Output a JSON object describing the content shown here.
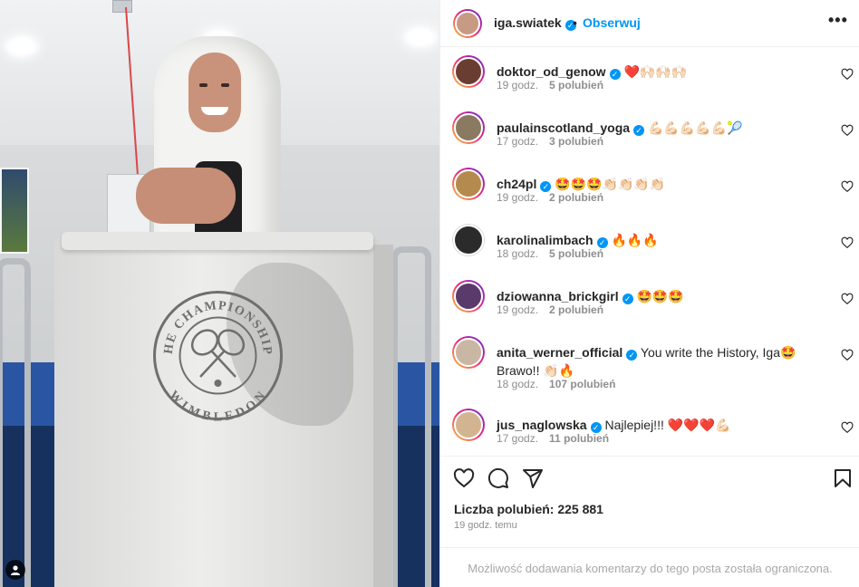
{
  "post": {
    "author": "iga.swiatek",
    "verified": true,
    "separator": "•",
    "follow_label": "Obserwuj",
    "more_icon": "more-horizontal-icon",
    "photo_logo_top": "THE CHAMPIONSHIPS",
    "photo_logo_bottom": "WIMBLEDON",
    "likes_label": "Liczba polubień: 225 881",
    "time_label": "19 godz. temu",
    "comments_restricted": "Możliwość dodawania komentarzy do tego posta została ograniczona."
  },
  "comments": [
    {
      "user": "doktor_od_genow",
      "text": "❤️🙌🏻🙌🏻🙌🏻",
      "time": "19 godz.",
      "likes": "5 polubień",
      "avatar_color": "#6a3d33"
    },
    {
      "user": "paulainscotland_yoga",
      "text": "💪🏻💪🏻💪🏻💪🏻💪🏻🎾",
      "time": "17 godz.",
      "likes": "3 polubień",
      "avatar_color": "#8a7a62"
    },
    {
      "user": "ch24pl",
      "text": "🤩🤩🤩👏🏻👏🏻👏🏻👏🏻",
      "time": "19 godz.",
      "likes": "2 polubień",
      "avatar_color": "#b58a4d"
    },
    {
      "user": "karolinalimbach",
      "text": "🔥🔥🔥",
      "time": "18 godz.",
      "likes": "5 polubień",
      "avatar_color": "#2b2b2b"
    },
    {
      "user": "dziowanna_brickgirl",
      "text": "🤩🤩🤩",
      "time": "19 godz.",
      "likes": "2 polubień",
      "avatar_color": "#5a3a6a"
    },
    {
      "user": "anita_werner_official",
      "text": "You write the History, Iga🤩 Brawo!! 👏🏻🔥",
      "time": "18 godz.",
      "likes": "107 polubień",
      "avatar_color": "#c9b7a3"
    },
    {
      "user": "jus_naglowska",
      "text": "Najlepiej!!! ❤️❤️❤️💪🏻",
      "time": "17 godz.",
      "likes": "11 polubień",
      "avatar_color": "#d2b590"
    }
  ],
  "colors": {
    "accent": "#0095f6",
    "text": "#262626",
    "muted": "#8e8e8e",
    "border": "#efefef"
  },
  "icons": [
    "heart-icon",
    "comment-icon",
    "share-icon",
    "bookmark-icon",
    "user-tag-icon"
  ]
}
